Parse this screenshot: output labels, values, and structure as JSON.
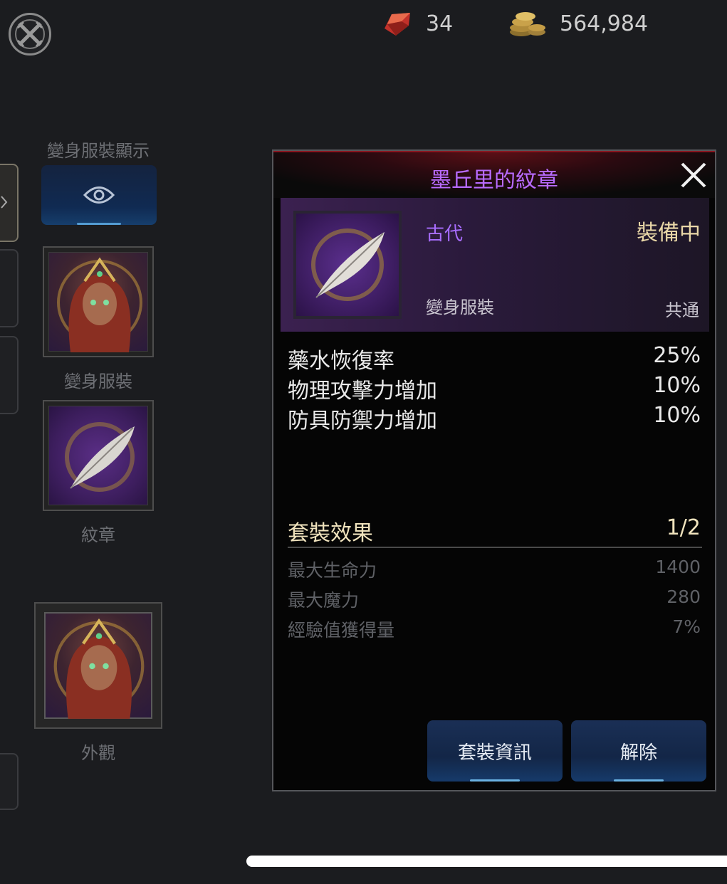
{
  "resources": {
    "gem_count": "34",
    "gold_count": "564,984"
  },
  "left_panel": {
    "display_label": "變身服裝顯示",
    "costume_slot_label": "變身服裝",
    "emblem_slot_label": "紋章",
    "appearance_slot_label": "外觀"
  },
  "dialog": {
    "title": "墨丘里的紋章",
    "grade": "古代",
    "status": "裝備中",
    "item_type": "變身服裝",
    "class_restriction": "共通",
    "stats": [
      {
        "name": "藥水恢復率",
        "value": "25%"
      },
      {
        "name": "物理攻擊力增加",
        "value": "10%"
      },
      {
        "name": "防具防禦力增加",
        "value": "10%"
      }
    ],
    "set_effect": {
      "title": "套裝效果",
      "count": "1/2",
      "effects": [
        {
          "name": "最大生命力",
          "value": "1400"
        },
        {
          "name": "最大魔力",
          "value": "280"
        },
        {
          "name": "經驗值獲得量",
          "value": "7%"
        }
      ]
    },
    "buttons": {
      "set_info": "套裝資訊",
      "unequip": "解除"
    }
  },
  "colors": {
    "title_purple": "#b86bff",
    "grade_purple": "#a86dff",
    "set_gold": "#f0e3bd",
    "button_blue": "#132647"
  }
}
